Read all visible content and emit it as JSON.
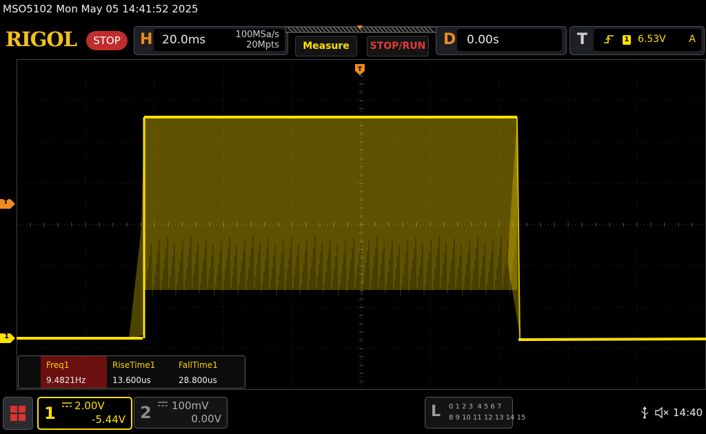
{
  "title_bar": {
    "text": "MSO5102  Mon May 05 14:41:52 2025"
  },
  "brand": {
    "logo": "RIGOL",
    "run_state": "STOP"
  },
  "horizontal": {
    "letter": "H",
    "timebase": "20.0ms",
    "sample_rate": "100MSa/s",
    "memory_depth": "20Mpts"
  },
  "buttons": {
    "measure": "Measure",
    "stop_run": "STOP/RUN"
  },
  "delay": {
    "letter": "D",
    "value": "0.00s"
  },
  "trigger": {
    "letter": "T",
    "edge_icon": "rising-edge-icon",
    "source": "1",
    "level": "6.53V",
    "mode": "A"
  },
  "markers": {
    "trigger_level": "T",
    "ch1_offset": "1"
  },
  "measurements": [
    {
      "name": "Freq1",
      "value": "9.4821Hz"
    },
    {
      "name": "RiseTime1",
      "value": "13.600us"
    },
    {
      "name": "FallTime1",
      "value": "28.800us"
    }
  ],
  "ch1": {
    "number": "1",
    "coupling_icon": "dc-coupling-icon",
    "scale": "2.00V",
    "offset": "-5.44V",
    "color": "#ffe000"
  },
  "ch2": {
    "number": "2",
    "coupling_icon": "dc-coupling-icon",
    "scale": "100mV",
    "offset": "0.00V",
    "color": "#8a8a8a"
  },
  "logic_analyzer": {
    "letter": "L",
    "row1": "0 1 2 3  4 5 6 7",
    "row2": "8 9 10 11 12 13 14 15"
  },
  "status": {
    "clock": "14:40",
    "usb_icon": "usb-icon",
    "speaker_icon": "speaker-muted-icon"
  },
  "waveform": {
    "type": "burst",
    "baseline_v": "-5.44V",
    "color": "#ffe000"
  }
}
